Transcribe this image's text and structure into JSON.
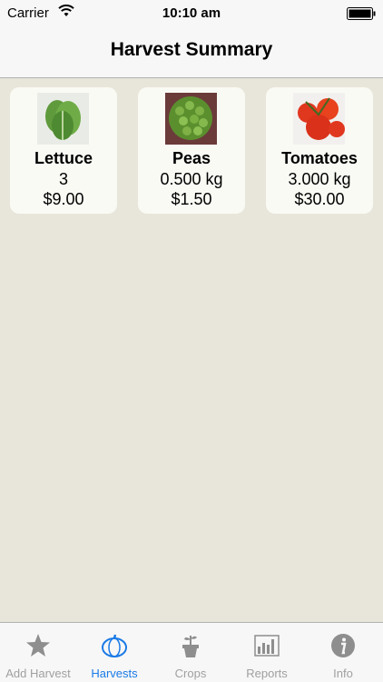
{
  "status_bar": {
    "carrier": "Carrier",
    "time": "10:10 am"
  },
  "nav": {
    "title": "Harvest Summary"
  },
  "harvests": [
    {
      "name": "Lettuce",
      "quantity": "3",
      "value": "$9.00",
      "image_icon": "lettuce-photo"
    },
    {
      "name": "Peas",
      "quantity": "0.500 kg",
      "value": "$1.50",
      "image_icon": "peas-photo"
    },
    {
      "name": "Tomatoes",
      "quantity": "3.000 kg",
      "value": "$30.00",
      "image_icon": "tomatoes-photo"
    }
  ],
  "tabs": [
    {
      "label": "Add Harvest",
      "icon": "star-icon",
      "active": false
    },
    {
      "label": "Harvests",
      "icon": "pumpkin-icon",
      "active": true
    },
    {
      "label": "Crops",
      "icon": "seedling-pot-icon",
      "active": false
    },
    {
      "label": "Reports",
      "icon": "bar-chart-icon",
      "active": false
    },
    {
      "label": "Info",
      "icon": "info-icon",
      "active": false
    }
  ],
  "colors": {
    "active_tab": "#1a7ae6",
    "inactive_tab": "#a0a0a0",
    "background": "#e8e6da"
  }
}
